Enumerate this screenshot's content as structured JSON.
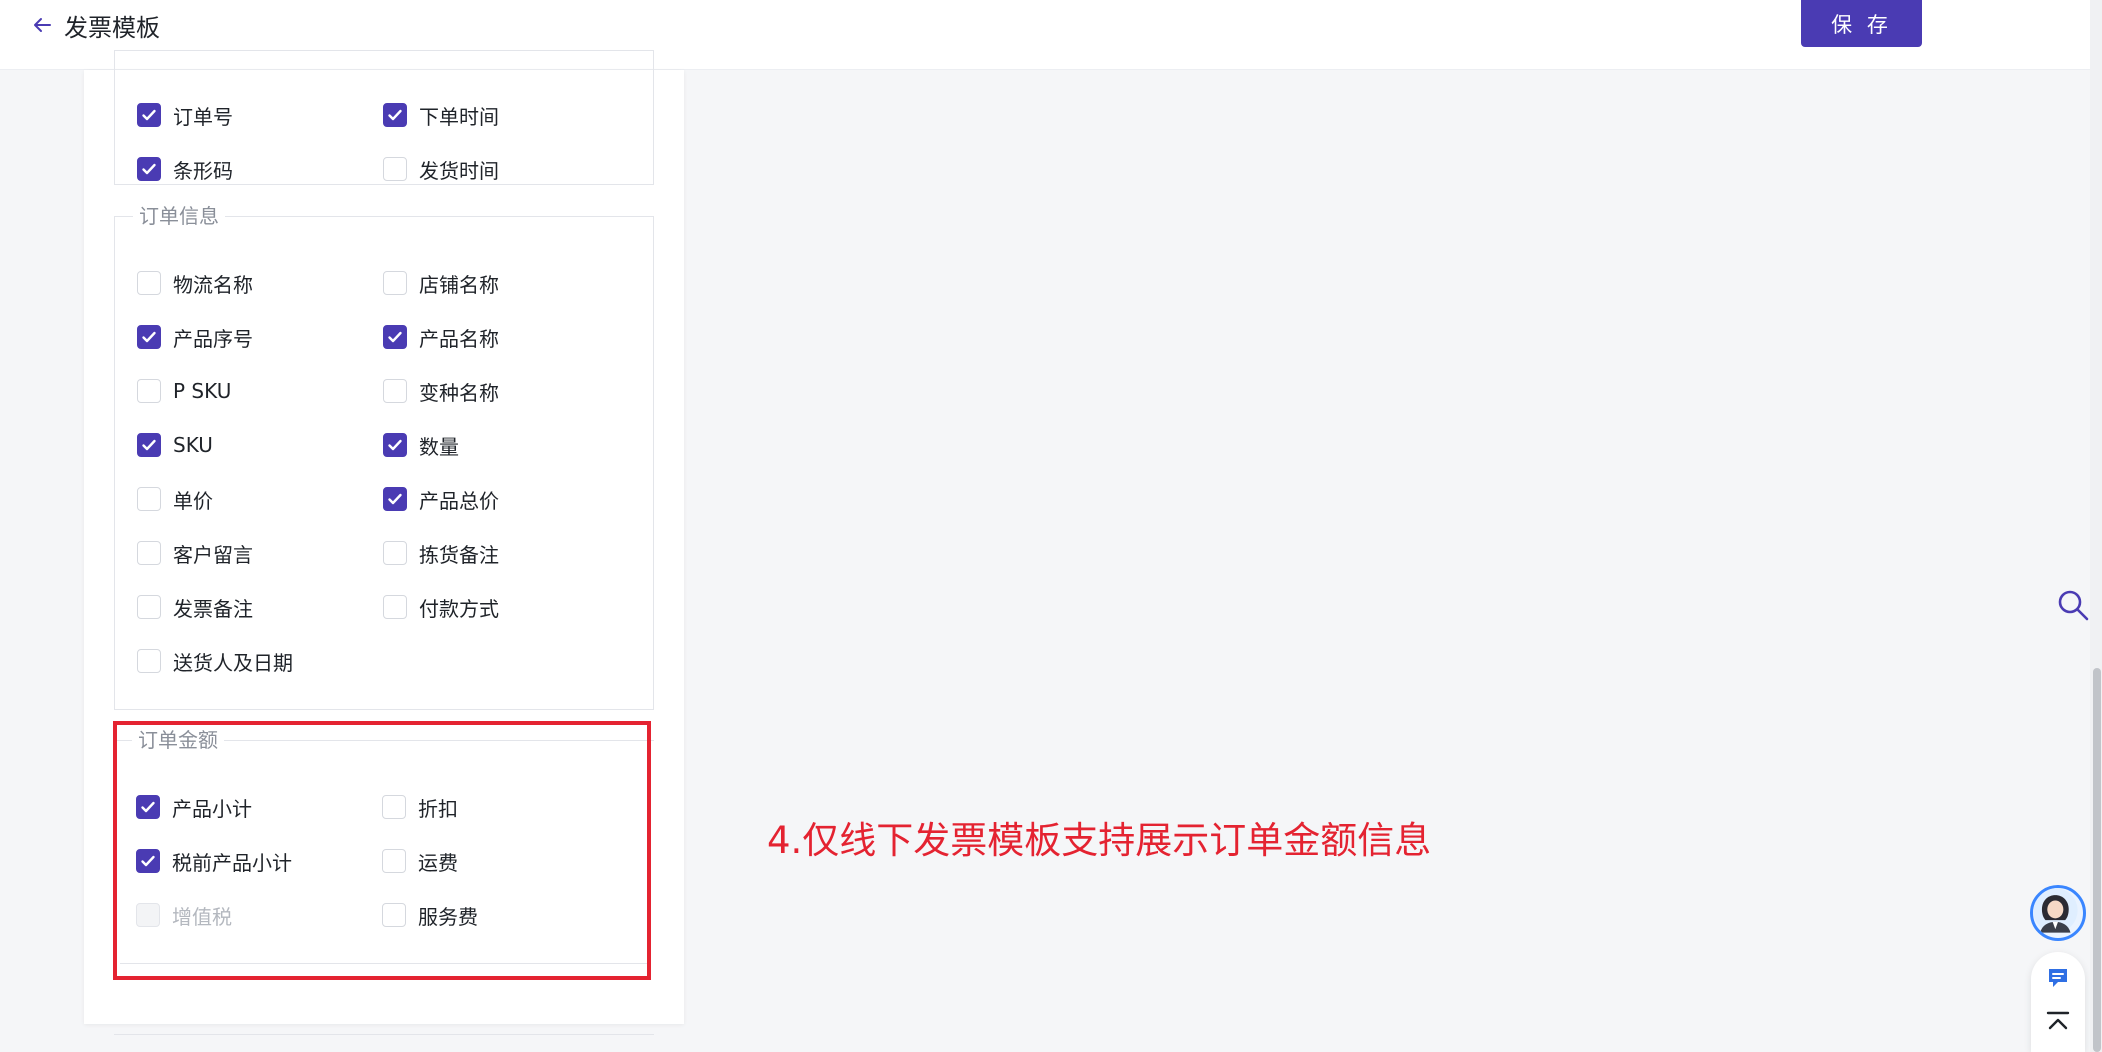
{
  "header": {
    "title": "发票模板",
    "save_label": "保 存"
  },
  "groups": {
    "top": {
      "items": [
        {
          "label": "订单号",
          "checked": true
        },
        {
          "label": "下单时间",
          "checked": true
        },
        {
          "label": "条形码",
          "checked": true
        },
        {
          "label": "发货时间",
          "checked": false
        }
      ]
    },
    "order_info": {
      "legend": "订单信息",
      "items": [
        {
          "label": "物流名称",
          "checked": false
        },
        {
          "label": "店铺名称",
          "checked": false
        },
        {
          "label": "产品序号",
          "checked": true
        },
        {
          "label": "产品名称",
          "checked": true
        },
        {
          "label": "P SKU",
          "checked": false
        },
        {
          "label": "变种名称",
          "checked": false
        },
        {
          "label": "SKU",
          "checked": true
        },
        {
          "label": "数量",
          "checked": true
        },
        {
          "label": "单价",
          "checked": false
        },
        {
          "label": "产品总价",
          "checked": true
        },
        {
          "label": "客户留言",
          "checked": false
        },
        {
          "label": "拣货备注",
          "checked": false
        },
        {
          "label": "发票备注",
          "checked": false
        },
        {
          "label": "付款方式",
          "checked": false
        },
        {
          "label": "送货人及日期",
          "checked": false
        }
      ]
    },
    "order_amount": {
      "legend": "订单金额",
      "items": [
        {
          "label": "产品小计",
          "checked": true
        },
        {
          "label": "折扣",
          "checked": false
        },
        {
          "label": "税前产品小计",
          "checked": true
        },
        {
          "label": "运费",
          "checked": false
        },
        {
          "label": "增值税",
          "checked": false,
          "disabled": true
        },
        {
          "label": "服务费",
          "checked": false
        }
      ]
    }
  },
  "annotation": "4.仅线下发票模板支持展示订单金额信息",
  "colors": {
    "accent": "#4a3bb3",
    "annotation": "#e42331",
    "float_icon": "#3a86ff"
  },
  "icons": {
    "back": "arrow-left-icon",
    "search": "search-icon",
    "chat": "chat-icon",
    "top": "back-to-top-icon"
  }
}
